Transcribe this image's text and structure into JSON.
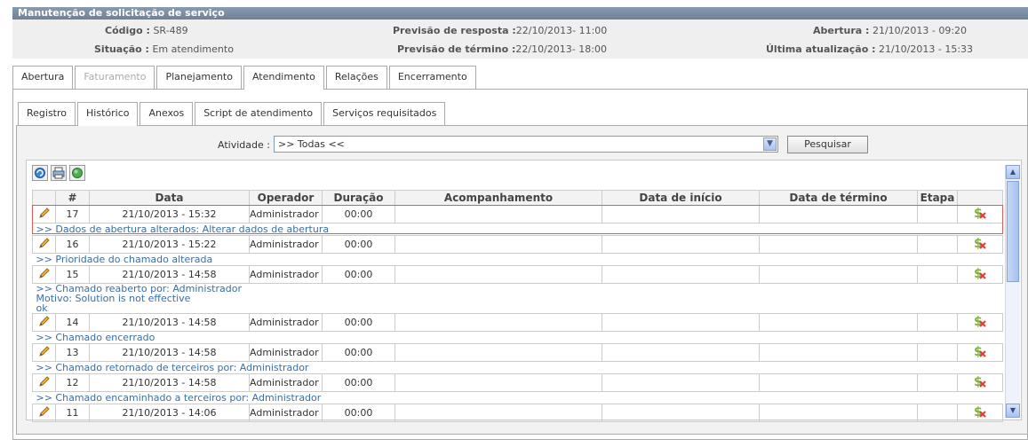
{
  "panel": {
    "title": "Manutenção de solicitação de serviço"
  },
  "info": {
    "codigo_label": "Código :",
    "codigo": "SR-489",
    "situacao_label": "Situação :",
    "situacao": "Em atendimento",
    "prev_resp_label": "Previsão de resposta :",
    "prev_resp": "22/10/2013- 11:00",
    "prev_term_label": "Previsão de término :",
    "prev_term": "22/10/2013- 18:00",
    "abertura_label": "Abertura :",
    "abertura": "21/10/2013 - 09:20",
    "ultima_label": "Última atualização :",
    "ultima": "21/10/2013 - 15:33"
  },
  "tabs1": [
    "Abertura",
    "Faturamento",
    "Planejamento",
    "Atendimento",
    "Relações",
    "Encerramento"
  ],
  "tabs2": [
    "Registro",
    "Histórico",
    "Anexos",
    "Script de atendimento",
    "Serviços requisitados"
  ],
  "filter": {
    "label": "Atividade :",
    "value": ">> Todas <<",
    "button": "Pesquisar"
  },
  "columns": [
    "#",
    "Data",
    "Operador",
    "Duração",
    "Acompanhamento",
    "Data de início",
    "Data de término",
    "Etapa"
  ],
  "rows": [
    {
      "num": "17",
      "data": "21/10/2013 - 15:32",
      "operador": "Administrador",
      "duracao": "00:00",
      "detail": ">> Dados de abertura alterados: Alterar dados de abertura"
    },
    {
      "num": "16",
      "data": "21/10/2013 - 15:22",
      "operador": "Administrador",
      "duracao": "00:00",
      "detail": ">> Prioridade do chamado alterada"
    },
    {
      "num": "15",
      "data": "21/10/2013 - 14:58",
      "operador": "Administrador",
      "duracao": "00:00",
      "detail": ">> Chamado reaberto por: Administrador",
      "detail2": "Motivo: Solution is not effective",
      "detail3": "ok"
    },
    {
      "num": "14",
      "data": "21/10/2013 - 14:58",
      "operador": "Administrador",
      "duracao": "00:00",
      "detail": ">> Chamado encerrado"
    },
    {
      "num": "13",
      "data": "21/10/2013 - 14:58",
      "operador": "Administrador",
      "duracao": "00:00",
      "detail": ">> Chamado retornado de terceiros por: Administrador"
    },
    {
      "num": "12",
      "data": "21/10/2013 - 14:58",
      "operador": "Administrador",
      "duracao": "00:00",
      "detail": ">> Chamado encaminhado a terceiros por: Administrador"
    },
    {
      "num": "11",
      "data": "21/10/2013 - 14:06",
      "operador": "Administrador",
      "duracao": "00:00"
    }
  ]
}
